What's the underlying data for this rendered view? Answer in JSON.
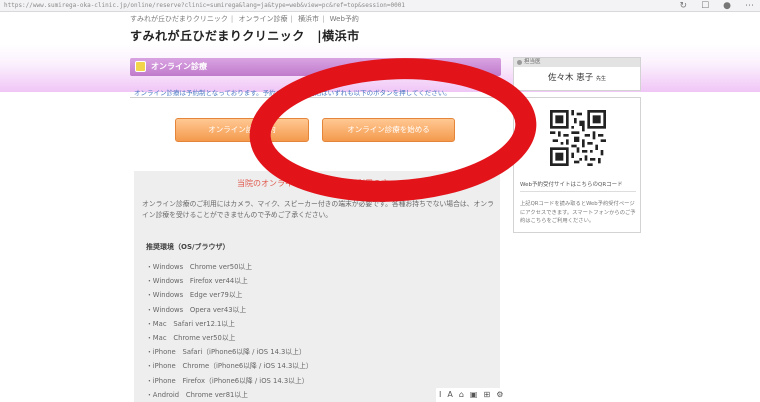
{
  "browser": {
    "url": "https://www.sumirega-oka-clinic.jp/online/reserve?clinic=sumirega&lang=ja&type=web&view=pc&ref=top&session=0001",
    "icons": [
      "refresh-icon",
      "tab-icon",
      "profile-icon",
      "menu-icon"
    ]
  },
  "breadcrumb": {
    "items": [
      "すみれが丘ひだまりクリニック",
      "オンライン診療",
      "横浜市",
      "Web予約"
    ]
  },
  "site_title": "すみれが丘ひだまりクリニック　|横浜市",
  "section": {
    "heading": "オンライン診療"
  },
  "notice": "オンライン診療は予約制となっております。予約または診察開始はいずれも以下のボタンを押してください。",
  "buttons": {
    "reserve": "オンライン診療予約",
    "start": "オンライン診療を始める"
  },
  "info": {
    "title": "当院のオンライン診療を初めてご利用の方へ",
    "body": "オンライン診療のご利用にはカメラ、マイク、スピーカー付きの端末が必要です。各種お持ちでない場合は、オンライン診療を受けることができませんので予めご了承ください。",
    "env_title": "推奨環境（OS/ブラウザ）",
    "env_list": [
      "・Windows　Chrome ver50以上",
      "・Windows　Firefox ver44以上",
      "・Windows　Edge ver79以上",
      "・Windows　Opera ver43以上",
      "・Mac　Safari ver12.1以上",
      "・Mac　Chrome ver50以上",
      "・iPhone　Safari（iPhone6以降 / iOS 14.3以上）",
      "・iPhone　Chrome（iPhone6以降 / iOS 14.3以上）",
      "・iPhone　Firefox（iPhone6以降 / iOS 14.3以上）",
      "・Android　Chrome ver81以上"
    ]
  },
  "sidebar": {
    "doctor_label": "担当医",
    "doctor_name": "佐々木 恵子",
    "doctor_suffix": "先生",
    "qr_caption": "Web予約受付サイトはこちらのQRコード",
    "qr_desc": "上記QRコードを読み取るとWeb予約受付ページにアクセスできます。スマートフォンからのご予約はこちらをご利用ください。"
  },
  "colors": {
    "accent_purple": "#c07bcb",
    "button_orange": "#f49a4d",
    "notice_blue": "#4a79c2",
    "title_red": "#e05a4e",
    "annotation_red": "#e3131a"
  },
  "mini_toolbar": {
    "icons": [
      "text-cursor-icon",
      "font-icon",
      "home-icon",
      "save-icon",
      "grid-icon",
      "settings-icon"
    ],
    "labels": [
      "I",
      "A",
      "⌂",
      "▣",
      "⊞",
      "⚙"
    ]
  }
}
